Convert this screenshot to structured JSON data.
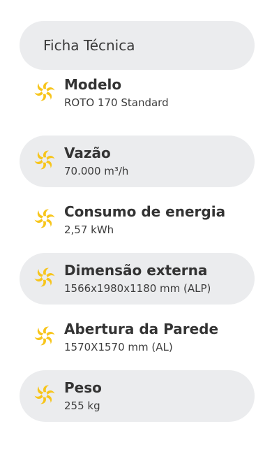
{
  "header": {
    "title": "Ficha Técnica"
  },
  "colors": {
    "accent": "#f7c51b",
    "pill": "#ebecee",
    "text": "#333333"
  },
  "specs": [
    {
      "title": "Modelo",
      "value": "ROTO 170 Standard",
      "icon": "fan-icon"
    },
    {
      "title": "Vazão",
      "value": "70.000 m³/h",
      "icon": "fan-icon"
    },
    {
      "title": "Consumo de energia",
      "value": "2,57 kWh",
      "icon": "fan-icon"
    },
    {
      "title": "Dimensão externa",
      "value": "1566x1980x1180 mm (ALP)",
      "icon": "fan-icon"
    },
    {
      "title": "Abertura da Parede",
      "value": "1570X1570 mm (AL)",
      "icon": "fan-icon"
    },
    {
      "title": "Peso",
      "value": "255 kg",
      "icon": "fan-icon"
    }
  ]
}
